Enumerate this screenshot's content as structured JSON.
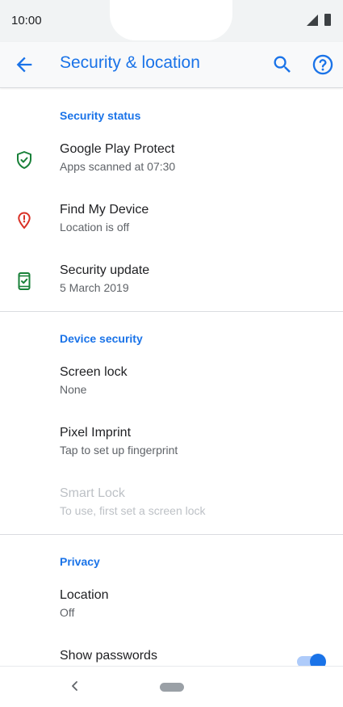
{
  "status_bar": {
    "time": "10:00"
  },
  "toolbar": {
    "title": "Security & location",
    "back_icon": "arrow-back-icon",
    "search_icon": "search-icon",
    "help_icon": "help-icon"
  },
  "sections": {
    "security_status": "Security status",
    "device_security": "Device security",
    "privacy": "Privacy"
  },
  "items": {
    "play_protect": {
      "title": "Google Play Protect",
      "subtitle": "Apps scanned at 07:30",
      "icon": "shield-check-icon"
    },
    "find_device": {
      "title": "Find My Device",
      "subtitle": "Location is off",
      "icon": "location-alert-icon"
    },
    "security_update": {
      "title": "Security update",
      "subtitle": "5 March 2019",
      "icon": "phone-check-icon"
    },
    "screen_lock": {
      "title": "Screen lock",
      "subtitle": "None"
    },
    "pixel_imprint": {
      "title": "Pixel Imprint",
      "subtitle": "Tap to set up fingerprint"
    },
    "smart_lock": {
      "title": "Smart Lock",
      "subtitle": "To use, first set a screen lock",
      "enabled": false
    },
    "location": {
      "title": "Location",
      "subtitle": "Off"
    },
    "show_passwords": {
      "title": "Show passwords",
      "toggle_on": true
    }
  },
  "colors": {
    "accent": "#1a73e8",
    "shield_green": "#188038",
    "alert_red": "#d93025"
  }
}
